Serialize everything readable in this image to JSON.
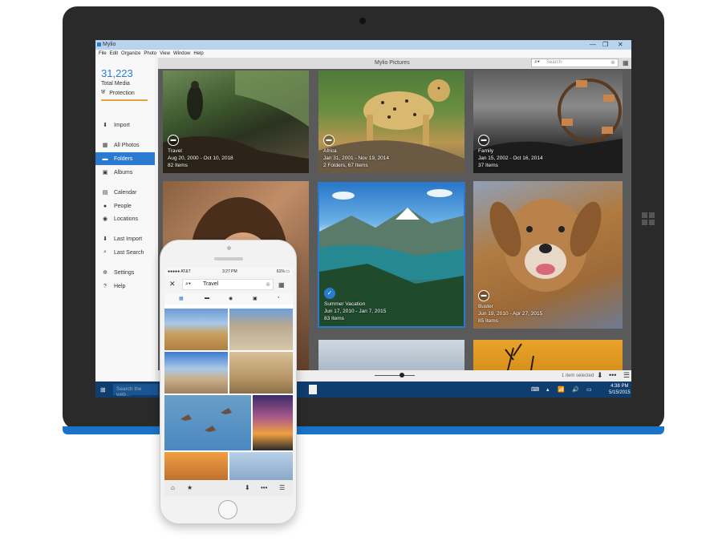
{
  "window": {
    "title": "Mylio",
    "menu": [
      "File",
      "Edit",
      "Organize",
      "Photo",
      "View",
      "Window",
      "Help"
    ],
    "controls": [
      "—",
      "❐",
      "✕"
    ]
  },
  "sidebar": {
    "media_count": "31,223",
    "media_label": "Total Media",
    "protection": "Protection",
    "items": [
      {
        "label": "Import",
        "icon": "import-icon"
      },
      {
        "label": "All Photos",
        "icon": "grid-icon"
      },
      {
        "label": "Folders",
        "icon": "folder-icon",
        "active": true
      },
      {
        "label": "Albums",
        "icon": "album-icon"
      },
      {
        "label": "Calendar",
        "icon": "calendar-icon"
      },
      {
        "label": "People",
        "icon": "person-icon"
      },
      {
        "label": "Locations",
        "icon": "pin-icon"
      },
      {
        "label": "Last Import",
        "icon": "import-icon"
      },
      {
        "label": "Last Search",
        "icon": "search-icon"
      },
      {
        "label": "Settings",
        "icon": "gear-icon"
      },
      {
        "label": "Help",
        "icon": "help-icon"
      }
    ]
  },
  "main": {
    "title": "Mylio Pictures",
    "search_placeholder": "Search",
    "tiles": [
      {
        "name": "Travel",
        "dates": "Aug 20, 2000 - Oct 10, 2018",
        "count": "82 Items"
      },
      {
        "name": "Africa",
        "dates": "Jan 31, 2001 - Nov 19, 2014",
        "count": "2 Folders, 67 Items"
      },
      {
        "name": "Family",
        "dates": "Jan 15, 2002 - Oct 16, 2014",
        "count": "37 Items"
      },
      {
        "name": "Summer Vacation",
        "dates": "Jun 17, 2010 - Jan 7, 2015",
        "count": "83 Items"
      },
      {
        "name": "Buster",
        "dates": "Jun 19, 2010 - Apr 27, 2015",
        "count": "85 Items"
      }
    ],
    "selection_text": "1 item selected"
  },
  "taskbar": {
    "search_placeholder": "Search the web...",
    "time": "4:38 PM",
    "date": "5/15/2015"
  },
  "phone": {
    "carrier": "●●●●● AT&T ",
    "time": "3:27 PM",
    "battery": "61% ▭",
    "search_value": "Travel"
  }
}
